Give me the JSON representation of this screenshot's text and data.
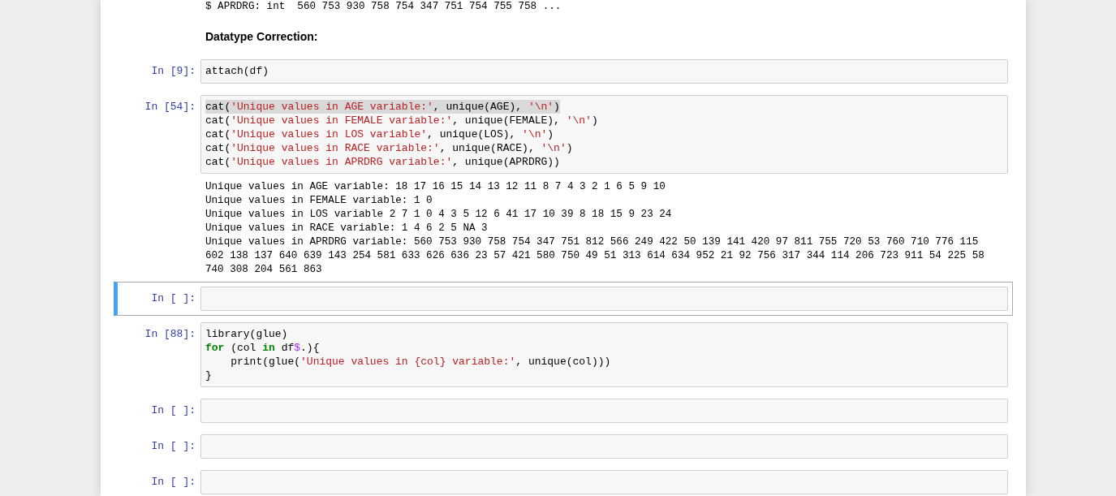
{
  "cells": [
    {
      "kind": "output",
      "lines": [
        "$ APRDRG: int  560 753 930 758 754 347 751 754 755 758 ..."
      ]
    },
    {
      "kind": "markdown",
      "text": "Datatype Correction:"
    },
    {
      "kind": "code",
      "prompt": "In [9]:",
      "active": false,
      "lines": [
        {
          "selected": false,
          "tokens": [
            {
              "kind": "plain",
              "text": "attach(df)"
            }
          ]
        }
      ]
    },
    {
      "kind": "code",
      "prompt": "In [54]:",
      "active": false,
      "lines": [
        {
          "selected": true,
          "tokens": [
            {
              "kind": "plain",
              "text": "cat("
            },
            {
              "kind": "string",
              "text": "'Unique values in AGE variable:'"
            },
            {
              "kind": "plain",
              "text": ", unique(AGE), "
            },
            {
              "kind": "string",
              "text": "'\\n'"
            },
            {
              "kind": "plain",
              "text": ")"
            }
          ]
        },
        {
          "selected": false,
          "tokens": [
            {
              "kind": "plain",
              "text": "cat("
            },
            {
              "kind": "string",
              "text": "'Unique values in FEMALE variable:'"
            },
            {
              "kind": "plain",
              "text": ", unique(FEMALE), "
            },
            {
              "kind": "string",
              "text": "'\\n'"
            },
            {
              "kind": "plain",
              "text": ")"
            }
          ]
        },
        {
          "selected": false,
          "tokens": [
            {
              "kind": "plain",
              "text": "cat("
            },
            {
              "kind": "string",
              "text": "'Unique values in LOS variable'"
            },
            {
              "kind": "plain",
              "text": ", unique(LOS), "
            },
            {
              "kind": "string",
              "text": "'\\n'"
            },
            {
              "kind": "plain",
              "text": ")"
            }
          ]
        },
        {
          "selected": false,
          "tokens": [
            {
              "kind": "plain",
              "text": "cat("
            },
            {
              "kind": "string",
              "text": "'Unique values in RACE variable:'"
            },
            {
              "kind": "plain",
              "text": ", unique(RACE), "
            },
            {
              "kind": "string",
              "text": "'\\n'"
            },
            {
              "kind": "plain",
              "text": ")"
            }
          ]
        },
        {
          "selected": false,
          "tokens": [
            {
              "kind": "plain",
              "text": "cat("
            },
            {
              "kind": "string",
              "text": "'Unique values in APRDRG variable:'"
            },
            {
              "kind": "plain",
              "text": ", unique(APRDRG))"
            }
          ]
        }
      ]
    },
    {
      "kind": "output",
      "lines": [
        "Unique values in AGE variable: 18 17 16 15 14 13 12 11 8 7 4 3 2 1 6 5 9 10",
        "Unique values in FEMALE variable: 1 0",
        "Unique values in LOS variable 2 7 1 0 4 3 5 12 6 41 17 10 39 8 18 15 9 23 24",
        "Unique values in RACE variable: 1 4 6 2 5 NA 3",
        "Unique values in APRDRG variable: 560 753 930 758 754 347 751 812 566 249 422 50 139 141 420 97 811 755 720 53 760 710 776 115",
        "602 138 137 640 639 143 254 581 633 626 636 23 57 421 580 750 49 51 313 614 634 952 21 92 756 317 344 114 206 723 911 54 225 58",
        "740 308 204 561 863"
      ]
    },
    {
      "kind": "code",
      "prompt": "In [ ]:",
      "active": true
    },
    {
      "kind": "code",
      "prompt": "In [88]:",
      "active": false,
      "lines": [
        {
          "selected": false,
          "tokens": [
            {
              "kind": "plain",
              "text": "library(glue)"
            }
          ]
        },
        {
          "selected": false,
          "tokens": [
            {
              "kind": "keyword",
              "text": "for"
            },
            {
              "kind": "plain",
              "text": " (col "
            },
            {
              "kind": "keyword",
              "text": "in"
            },
            {
              "kind": "plain",
              "text": " df"
            },
            {
              "kind": "operator",
              "text": "$"
            },
            {
              "kind": "plain",
              "text": ".){"
            }
          ]
        },
        {
          "selected": false,
          "tokens": [
            {
              "kind": "plain",
              "text": "    print(glue("
            },
            {
              "kind": "string",
              "text": "'Unique values in {col} variable:'"
            },
            {
              "kind": "plain",
              "text": ", unique(col)))"
            }
          ]
        },
        {
          "selected": false,
          "tokens": [
            {
              "kind": "plain",
              "text": "}"
            }
          ]
        }
      ]
    },
    {
      "kind": "code",
      "prompt": "In [ ]:",
      "active": false
    },
    {
      "kind": "code",
      "prompt": "In [ ]:",
      "active": false
    },
    {
      "kind": "code",
      "prompt": "In [ ]:",
      "active": false
    }
  ]
}
